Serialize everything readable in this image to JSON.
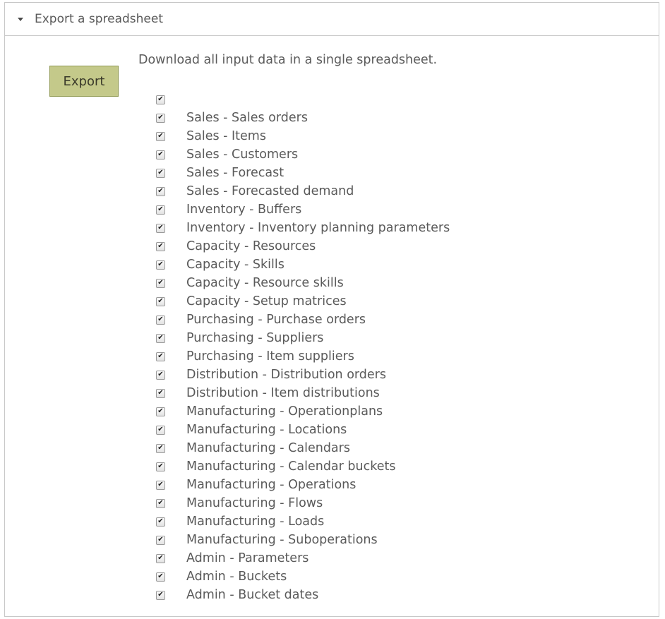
{
  "panel": {
    "title": "Export a spreadsheet",
    "description": "Download all input data in a single spreadsheet.",
    "export_label": "Export",
    "check_glyph": "✔",
    "items": [
      {
        "label": "",
        "checked": true
      },
      {
        "label": "Sales - Sales orders",
        "checked": true
      },
      {
        "label": "Sales - Items",
        "checked": true
      },
      {
        "label": "Sales - Customers",
        "checked": true
      },
      {
        "label": "Sales - Forecast",
        "checked": true
      },
      {
        "label": "Sales - Forecasted demand",
        "checked": true
      },
      {
        "label": "Inventory - Buffers",
        "checked": true
      },
      {
        "label": "Inventory - Inventory planning parameters",
        "checked": true
      },
      {
        "label": "Capacity - Resources",
        "checked": true
      },
      {
        "label": "Capacity - Skills",
        "checked": true
      },
      {
        "label": "Capacity - Resource skills",
        "checked": true
      },
      {
        "label": "Capacity - Setup matrices",
        "checked": true
      },
      {
        "label": "Purchasing - Purchase orders",
        "checked": true
      },
      {
        "label": "Purchasing - Suppliers",
        "checked": true
      },
      {
        "label": "Purchasing - Item suppliers",
        "checked": true
      },
      {
        "label": "Distribution - Distribution orders",
        "checked": true
      },
      {
        "label": "Distribution - Item distributions",
        "checked": true
      },
      {
        "label": "Manufacturing - Operationplans",
        "checked": true
      },
      {
        "label": "Manufacturing - Locations",
        "checked": true
      },
      {
        "label": "Manufacturing - Calendars",
        "checked": true
      },
      {
        "label": "Manufacturing - Calendar buckets",
        "checked": true
      },
      {
        "label": "Manufacturing - Operations",
        "checked": true
      },
      {
        "label": "Manufacturing - Flows",
        "checked": true
      },
      {
        "label": "Manufacturing - Loads",
        "checked": true
      },
      {
        "label": "Manufacturing - Suboperations",
        "checked": true
      },
      {
        "label": "Admin - Parameters",
        "checked": true
      },
      {
        "label": "Admin - Buckets",
        "checked": true
      },
      {
        "label": "Admin - Bucket dates",
        "checked": true
      }
    ]
  }
}
